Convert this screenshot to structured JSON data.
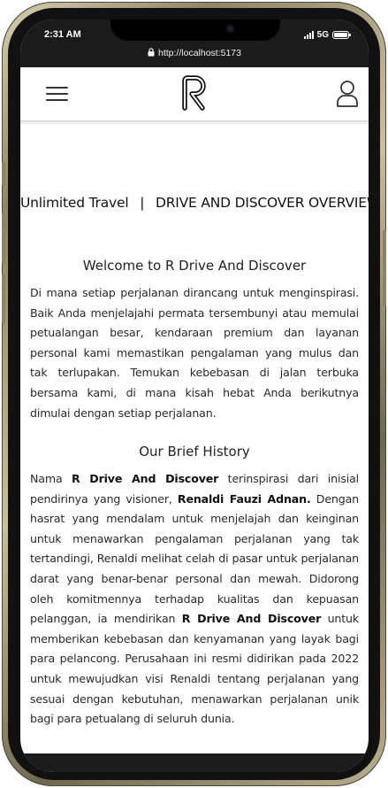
{
  "status": {
    "time": "2:31 AM",
    "network": "5G"
  },
  "browser": {
    "url": "http://localhost:5173"
  },
  "header": {
    "menu_icon": "hamburger-icon",
    "logo_icon": "r-logo",
    "user_icon": "user-icon"
  },
  "page": {
    "tagline": "Unlimited Travel",
    "separator": "|",
    "title": "DRIVE AND DISCOVER OVERVIEW",
    "welcome": {
      "title": "Welcome to R Drive And Discover",
      "text": "Di mana setiap perjalanan dirancang untuk menginspirasi. Baik Anda menjelajahi permata tersembunyi atau memulai petualangan besar, kendaraan premium dan layanan personal kami memastikan pengalaman yang mulus dan tak terlupakan. Temukan kebebasan di jalan terbuka bersama kami, di mana kisah hebat Anda berikutnya dimulai dengan setiap perjalanan."
    },
    "history": {
      "title": "Our Brief History",
      "p1": "Nama ",
      "brand1": "R Drive And Discover",
      "p2": " terinspirasi dari inisial pendirinya yang visioner, ",
      "founder": "Renaldi Fauzi Adnan.",
      "p3": " Dengan hasrat yang mendalam untuk menjelajah dan keinginan untuk menawarkan pengalaman perjalanan yang tak tertandingi, Renaldi melihat celah di pasar untuk perjalanan darat yang benar-benar personal dan mewah. Didorong oleh komitmennya terhadap kualitas dan kepuasan pelanggan, ia mendirikan ",
      "brand2": "R Drive And Discover",
      "p4": " untuk memberikan kebebasan dan kenyamanan yang layak bagi para pelancong. Perusahaan ini resmi didirikan pada 2022 untuk mewujudkan visi Renaldi tentang perjalanan yang sesuai dengan kebutuhan, menawarkan perjalanan unik bagi para petualang di seluruh dunia."
    }
  }
}
